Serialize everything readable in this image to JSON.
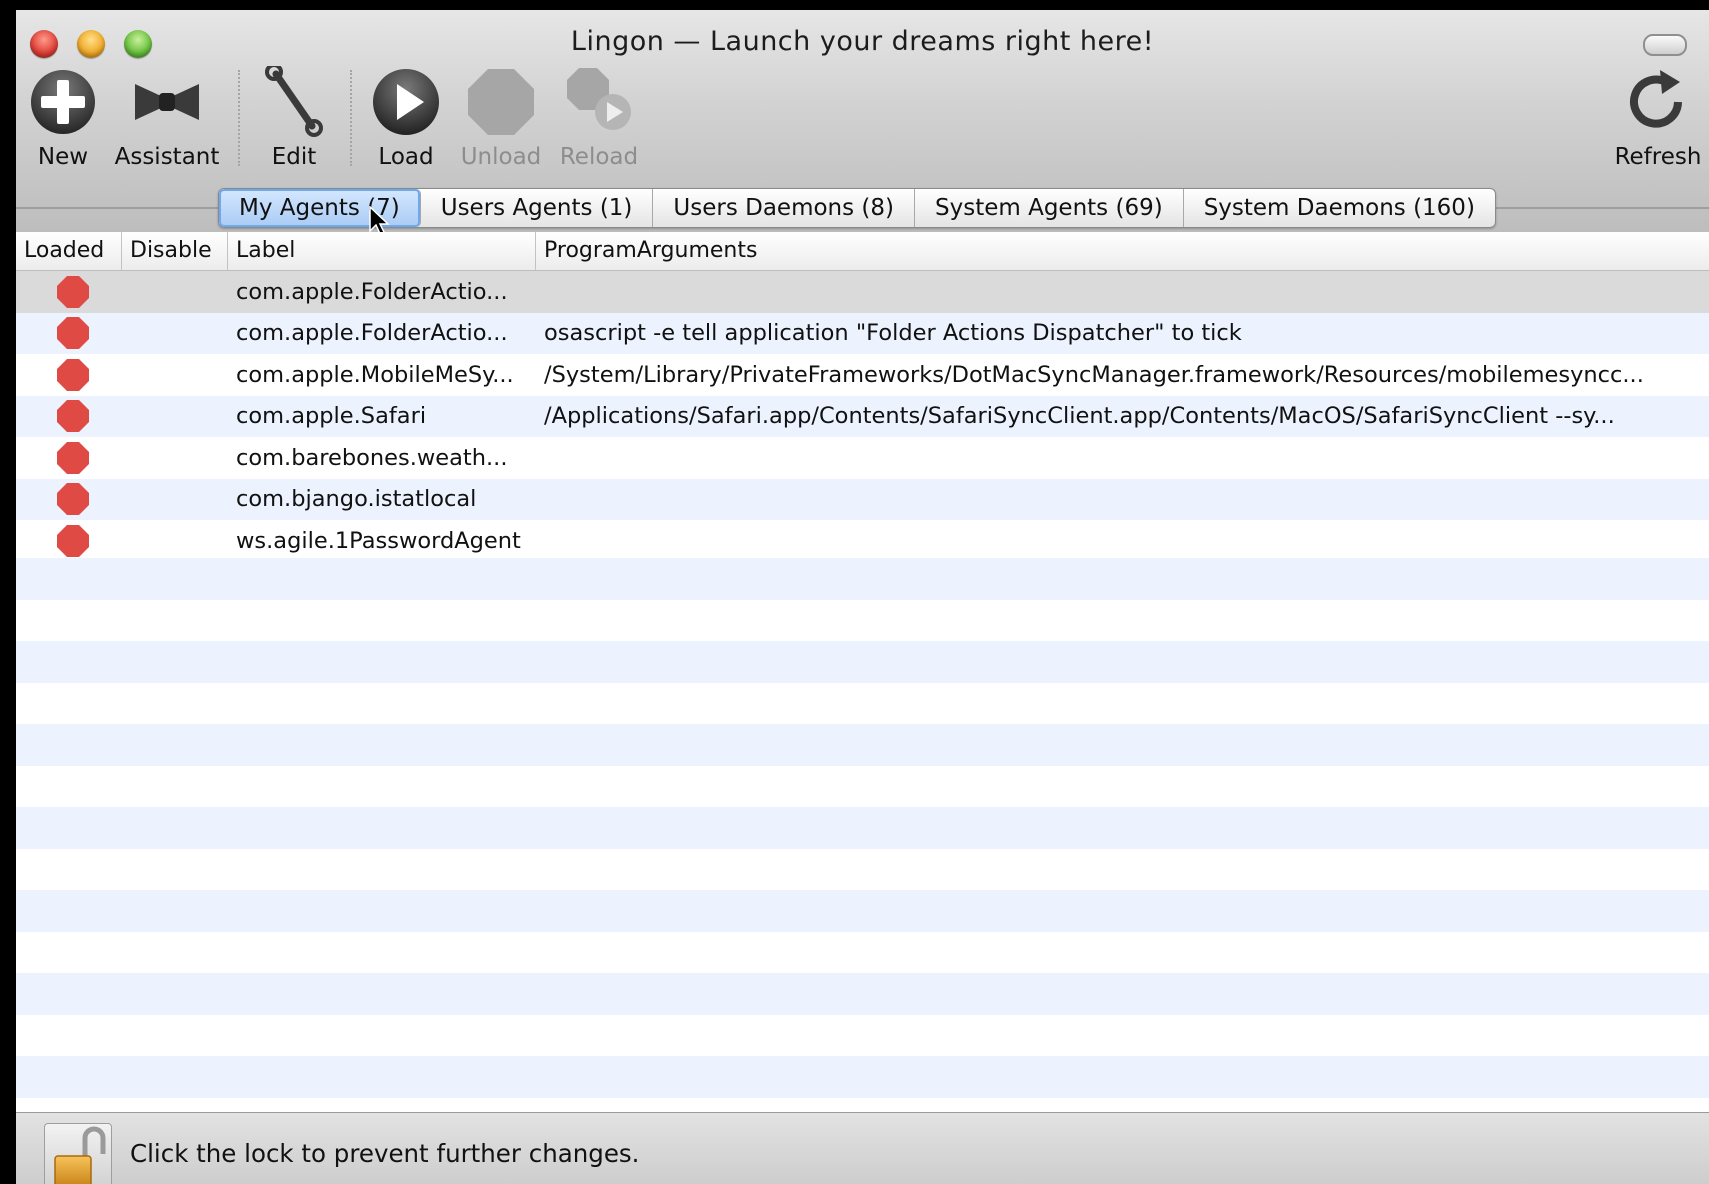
{
  "window": {
    "title": "Lingon  —  Launch your dreams right here!"
  },
  "toolbar": {
    "items": [
      {
        "label": "New",
        "icon": "plus-circle-icon",
        "enabled": true
      },
      {
        "label": "Assistant",
        "icon": "bowtie-icon",
        "enabled": true
      },
      {
        "label": "Edit",
        "icon": "wrench-icon",
        "enabled": true
      },
      {
        "label": "Load",
        "icon": "play-icon",
        "enabled": true
      },
      {
        "label": "Unload",
        "icon": "stop-octagon-icon",
        "enabled": false
      },
      {
        "label": "Reload",
        "icon": "reload-icon",
        "enabled": false
      },
      {
        "label": "Refresh",
        "icon": "refresh-icon",
        "enabled": true
      }
    ]
  },
  "tabs": [
    {
      "label": "My Agents (7)",
      "active": true
    },
    {
      "label": "Users Agents (1)",
      "active": false
    },
    {
      "label": "Users Daemons (8)",
      "active": false
    },
    {
      "label": "System Agents (69)",
      "active": false
    },
    {
      "label": "System Daemons (160)",
      "active": false
    }
  ],
  "table": {
    "columns": [
      "Loaded",
      "Disable",
      "Label",
      "ProgramArguments"
    ],
    "rows": [
      {
        "loaded": "stop",
        "label": "com.apple.FolderActio...",
        "args": ""
      },
      {
        "loaded": "stop",
        "label": "com.apple.FolderActio...",
        "args": "osascript -e tell application \"Folder Actions Dispatcher\" to tick"
      },
      {
        "loaded": "stop",
        "label": "com.apple.MobileMeSy...",
        "args": "/System/Library/PrivateFrameworks/DotMacSyncManager.framework/Resources/mobilemesyncc..."
      },
      {
        "loaded": "stop",
        "label": "com.apple.Safari",
        "args": "/Applications/Safari.app/Contents/SafariSyncClient.app/Contents/MacOS/SafariSyncClient --sy..."
      },
      {
        "loaded": "stop",
        "label": "com.barebones.weath...",
        "args": ""
      },
      {
        "loaded": "stop",
        "label": "com.bjango.istatlocal",
        "args": ""
      },
      {
        "loaded": "stop",
        "label": "ws.agile.1PasswordAgent",
        "args": ""
      }
    ]
  },
  "footer": {
    "lock_text": "Click the lock to prevent further changes.",
    "lock_icon": "open-lock-icon"
  },
  "colors": {
    "stop_red": "#e04a45",
    "tab_active": "#a9cbf5",
    "row_alt": "#edf3fe"
  }
}
